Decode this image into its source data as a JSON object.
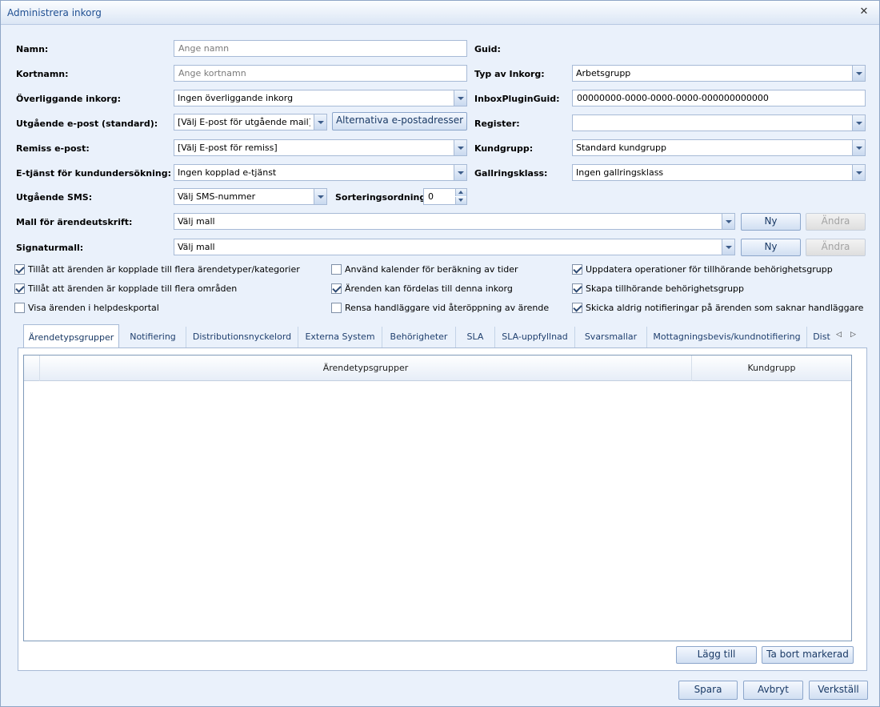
{
  "window": {
    "title": "Administrera inkorg"
  },
  "form": {
    "namn": {
      "label": "Namn:",
      "placeholder": "Ange namn"
    },
    "kortnamn": {
      "label": "Kortnamn:",
      "placeholder": "Ange kortnamn"
    },
    "overliggande": {
      "label": "Överliggande inkorg:",
      "value": "Ingen överliggande inkorg"
    },
    "utgaende_epost": {
      "label": "Utgående e-post (standard):",
      "value": "[Välj E-post för utgående mail]",
      "alt_button": "Alternativa e-postadresser"
    },
    "remiss": {
      "label": "Remiss e-post:",
      "value": "[Välj E-post för remiss]"
    },
    "etjanst": {
      "label": "E-tjänst för kundundersökning:",
      "value": "Ingen kopplad e-tjänst"
    },
    "sms": {
      "label": "Utgående SMS:",
      "value": "Välj SMS-nummer"
    },
    "sortering": {
      "label": "Sorteringsordning:",
      "value": "0"
    },
    "mall_utskrift": {
      "label": "Mall för ärendeutskrift:",
      "value": "Välj mall",
      "new_button": "Ny",
      "edit_button": "Ändra"
    },
    "signaturmall": {
      "label": "Signaturmall:",
      "value": "Välj mall",
      "new_button": "Ny",
      "edit_button": "Ändra"
    },
    "guid": {
      "label": "Guid:"
    },
    "typ": {
      "label": "Typ av Inkorg:",
      "value": "Arbetsgrupp"
    },
    "plugin_guid": {
      "label": "InboxPluginGuid:",
      "value": "00000000-0000-0000-0000-000000000000"
    },
    "register": {
      "label": "Register:",
      "value": ""
    },
    "kundgrupp": {
      "label": "Kundgrupp:",
      "value": "Standard kundgrupp"
    },
    "gallring": {
      "label": "Gallringsklass:",
      "value": "Ingen gallringsklass"
    }
  },
  "checkboxes": [
    {
      "label": "Tillåt att ärenden är kopplade till flera ärendetyper/kategorier",
      "checked": true
    },
    {
      "label": "Tillåt att ärenden är kopplade till flera områden",
      "checked": true
    },
    {
      "label": "Visa ärenden i helpdeskportal",
      "checked": false
    },
    {
      "label": "Använd kalender för beräkning av tider",
      "checked": false
    },
    {
      "label": "Ärenden kan fördelas till denna inkorg",
      "checked": true
    },
    {
      "label": "Rensa handläggare vid återöppning av ärende",
      "checked": false
    },
    {
      "label": "Uppdatera operationer för tillhörande behörighetsgrupp",
      "checked": true
    },
    {
      "label": "Skapa tillhörande behörighetsgrupp",
      "checked": true
    },
    {
      "label": "Skicka aldrig notifieringar på ärenden som saknar handläggare",
      "checked": true
    }
  ],
  "tabs": [
    {
      "label": "Ärendetypsgrupper",
      "active": true
    },
    {
      "label": "Notifiering"
    },
    {
      "label": "Distributionsnyckelord"
    },
    {
      "label": "Externa System"
    },
    {
      "label": "Behörigheter"
    },
    {
      "label": "SLA"
    },
    {
      "label": "SLA-uppfyllnad"
    },
    {
      "label": "Svarsmallar"
    },
    {
      "label": "Mottagningsbevis/kundnotifiering"
    },
    {
      "label": "Dist"
    }
  ],
  "grid": {
    "columns": [
      "Ärendetypsgrupper",
      "Kundgrupp"
    ],
    "add_button": "Lägg till",
    "remove_button": "Ta bort markerad"
  },
  "footer": {
    "save": "Spara",
    "cancel": "Avbryt",
    "apply": "Verkställ"
  },
  "colors": {
    "accent": "#1f4f92",
    "panel_bg": "#eaf1fb",
    "border": "#a7bad6"
  }
}
